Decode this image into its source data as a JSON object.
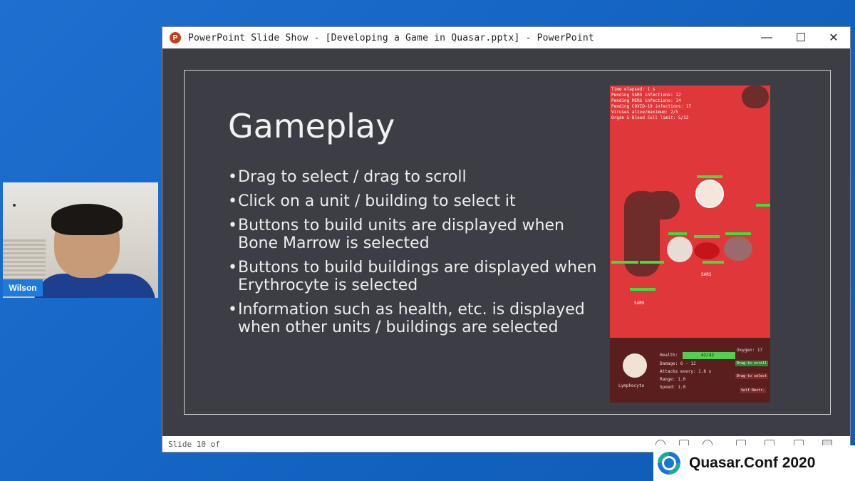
{
  "webcam": {
    "participant_name": "Wilson"
  },
  "window": {
    "title": "PowerPoint Slide Show - [Developing a Game in Quasar.pptx] - PowerPoint",
    "app_icon": "powerpoint-icon",
    "controls": {
      "minimize": "—",
      "maximize": "☐",
      "close": "✕"
    }
  },
  "slide": {
    "title": "Gameplay",
    "bullets": [
      "Drag to select / drag to scroll",
      "Click on a unit / building to select it",
      "Buttons to build units are displayed when Bone Marrow is selected",
      "Buttons to build buildings are displayed when Erythrocyte is selected",
      "Information such as health, etc. is displayed when other units / buildings are selected"
    ],
    "bullet_glyph": "•"
  },
  "game": {
    "hud_lines": [
      "Time elapsed: 1 s",
      "Pending SARS infections: 12",
      "Pending MERS infections: 14",
      "Pending COVID-19 infections: 17",
      "Viruses alive/maximum: 2/5",
      "Organ & Blood Cell limit: 5/12"
    ],
    "unit_labels": {
      "sars_a": "SARS",
      "sars_b": "SARS"
    },
    "selected_unit": "Lymphocyte",
    "health": "42/42",
    "stats": [
      "Damage: 6 - 12",
      "Attacks every: 1.8 s",
      "Range: 1.0",
      "Speed: 1.0"
    ],
    "health_label": "Health:",
    "oxygen": "Oxygen: 17",
    "buttons": [
      "Drag to scroll",
      "Drag to select",
      "Self Destr."
    ]
  },
  "statusbar": {
    "slide_text": "Slide 10 of"
  },
  "conference": {
    "name": "Quasar.Conf 2020"
  },
  "colors": {
    "desktop_blue": "#1565c4",
    "slide_bg": "#3d3e45",
    "game_red": "#e0383a",
    "hp_green": "#39e23a"
  }
}
